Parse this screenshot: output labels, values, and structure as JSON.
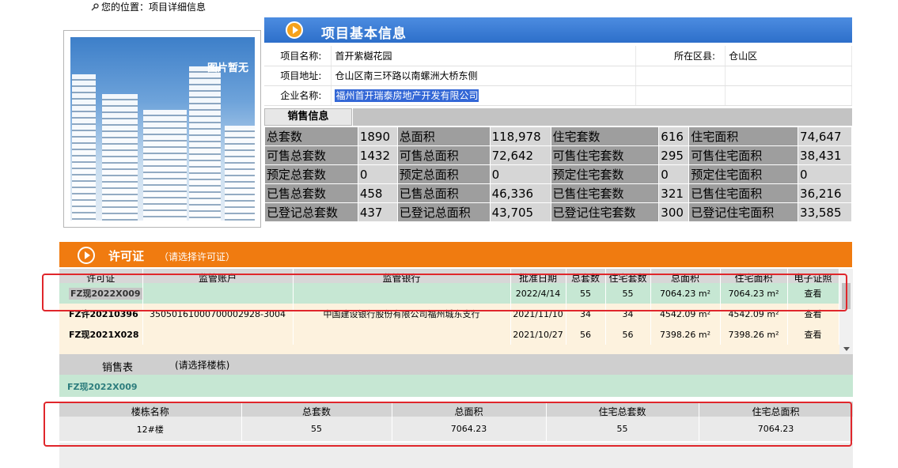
{
  "breadcrumb": {
    "text": "您的位置：项目详细信息"
  },
  "photo": {
    "caption": "图片暂无"
  },
  "project_section": {
    "title": "项目基本信息",
    "name_label": "项目名称:",
    "name_value": "首开紫樾花园",
    "district_label": "所在区县:",
    "district_value": "仓山区",
    "address_label": "项目地址:",
    "address_value": "仓山区南三环路以南螺洲大桥东侧",
    "company_label": "企业名称:",
    "company_value": "福州首开瑞泰房地产开发有限公司"
  },
  "sales_info": {
    "tab_label": "销售信息",
    "rows": [
      [
        [
          "总套数",
          "1890"
        ],
        [
          "总面积",
          "118,978"
        ],
        [
          "住宅套数",
          "616"
        ],
        [
          "住宅面积",
          "74,647"
        ]
      ],
      [
        [
          "可售总套数",
          "1432"
        ],
        [
          "可售总面积",
          "72,642"
        ],
        [
          "可售住宅套数",
          "295"
        ],
        [
          "可售住宅面积",
          "38,431"
        ]
      ],
      [
        [
          "预定总套数",
          "0"
        ],
        [
          "预定总面积",
          "0"
        ],
        [
          "预定住宅套数",
          "0"
        ],
        [
          "预定住宅面积",
          "0"
        ]
      ],
      [
        [
          "已售总套数",
          "458"
        ],
        [
          "已售总面积",
          "46,336"
        ],
        [
          "已售住宅套数",
          "321"
        ],
        [
          "已售住宅面积",
          "36,216"
        ]
      ],
      [
        [
          "已登记总套数",
          "437"
        ],
        [
          "已登记总面积",
          "43,705"
        ],
        [
          "已登记住宅套数",
          "300"
        ],
        [
          "已登记住宅面积",
          "33,585"
        ]
      ]
    ]
  },
  "permit_section": {
    "title": "许可证",
    "hint": "（请选择许可证）",
    "headers": [
      "许可证",
      "监管账户",
      "监管银行",
      "批准日期",
      "总套数",
      "住宅套数",
      "总面积",
      "住宅面积",
      "电子证照"
    ],
    "rows": [
      {
        "id": "FZ现2022X009",
        "account": "",
        "bank": "",
        "date": "2022/4/14",
        "total": "55",
        "residential": "55",
        "area": "7064.23 m²",
        "res_area": "7064.23 m²",
        "action": "查看"
      },
      {
        "id": "FZ许20210396",
        "account": "35050161000700002928-3004",
        "bank": "中国建设银行股份有限公司福州城东支行",
        "date": "2021/11/10",
        "total": "34",
        "residential": "34",
        "area": "4542.09 m²",
        "res_area": "4542.09 m²",
        "action": "查看"
      },
      {
        "id": "FZ现2021X028",
        "account": "",
        "bank": "",
        "date": "2021/10/27",
        "total": "56",
        "residential": "56",
        "area": "7398.26 m²",
        "res_area": "7398.26 m²",
        "action": "查看"
      }
    ]
  },
  "sales_table": {
    "title": "销售表",
    "hint": "(请选择楼栋)",
    "selected_permit": "FZ现2022X009",
    "headers": [
      "楼栋名称",
      "总套数",
      "总面积",
      "住宅总套数",
      "住宅总面积"
    ],
    "rows": [
      {
        "name": "12#楼",
        "total": "55",
        "area": "7064.23",
        "res_total": "55",
        "res_area": "7064.23"
      }
    ]
  },
  "colors": {
    "blue_header": "#2d6fca",
    "orange_header": "#f07b10",
    "selected_row": "#c6e7d3",
    "red_box": "#e0262b"
  }
}
